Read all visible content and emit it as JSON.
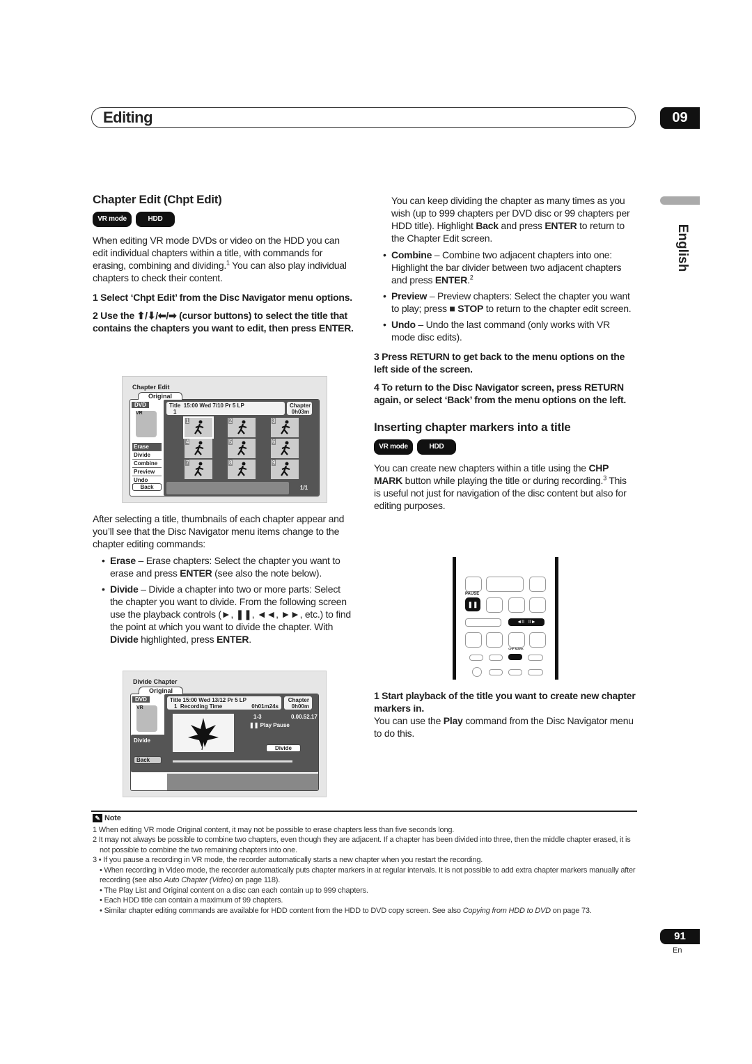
{
  "header": {
    "section_title": "Editing",
    "chapter_number": "09",
    "language_tab": "English"
  },
  "left": {
    "heading": "Chapter Edit (Chpt Edit)",
    "badges": [
      "VR mode",
      "HDD"
    ],
    "intro": [
      {
        "t": "When editing VR mode DVDs or video on the HDD you can edit individual chapters within a title, with commands for erasing, combining and dividing."
      },
      {
        "sup": "1"
      },
      {
        "t": " You can also play individual chapters to check their content."
      }
    ],
    "step1": "1   Select ‘Chpt Edit’ from the Disc Navigator menu options.",
    "step2": "2   Use the ⬆/⬇/⬅/➡ (cursor buttons) to select the title that contains the chapters you want to edit, then press ENTER.",
    "after": "After selecting a title, thumbnails of each chapter appear and you’ll see that the Disc Navigator menu items change to the chapter editing commands:",
    "bullets": [
      [
        {
          "t": "Erase",
          "b": true
        },
        {
          "t": " – Erase chapters: Select the chapter you want to erase and press "
        },
        {
          "t": "ENTER",
          "b": true
        },
        {
          "t": " (see also the note below)."
        }
      ],
      [
        {
          "t": "Divide",
          "b": true
        },
        {
          "t": " – Divide a chapter into two or more parts: Select the chapter you want to divide. From the following screen use the playback controls (►, ❚❚, ◄◄, ►►, etc.) to find the point at which you want to divide the chapter. With "
        },
        {
          "t": "Divide",
          "b": true
        },
        {
          "t": " highlighted, press "
        },
        {
          "t": "ENTER",
          "b": true
        },
        {
          "t": "."
        }
      ]
    ]
  },
  "screen1": {
    "title": "Chapter Edit",
    "tab": "Original",
    "disc": "DVD",
    "disc_mode": "VR",
    "info_title": "Title",
    "info_title_num": "1",
    "info_text": "15:00 Wed  7/10 Pr 5   LP",
    "info_chapter": "Chapter",
    "info_chapter_time": "0h03m",
    "thumbnails": [
      "1",
      "2",
      "3",
      "4",
      "5",
      "6",
      "7",
      "8",
      "9"
    ],
    "menu": [
      "Erase",
      "Divide",
      "Combine",
      "Preview",
      "Undo"
    ],
    "selected_menu": "Erase",
    "back": "Back",
    "page": "1/1"
  },
  "screen2": {
    "title": "Divide Chapter",
    "tab": "Original",
    "disc": "DVD",
    "disc_mode": "VR",
    "info_title": "Title",
    "info_title_num": "1",
    "info_line1": "15:00 Wed  13/12   Pr 5     LP",
    "info_line2_label": "Recording Time",
    "info_line2_value": "0h01m24s",
    "info_chapter": "Chapter",
    "info_chapter_time": "0h00m",
    "chapter_pos": "1-3",
    "timecode": "0.00.52.17",
    "status": "❚❚ Play Pause",
    "menu_item": "Divide",
    "divide_button": "Divide",
    "back": "Back"
  },
  "right": {
    "cont": [
      {
        "t": "You can keep dividing the chapter as many times as you wish (up to 999 chapters per DVD disc or 99 chapters per HDD title). Highlight "
      },
      {
        "t": "Back",
        "b": true
      },
      {
        "t": " and press "
      },
      {
        "t": "ENTER",
        "b": true
      },
      {
        "t": " to return to the Chapter Edit screen."
      }
    ],
    "bullets": [
      [
        {
          "t": "Combine",
          "b": true
        },
        {
          "t": " – Combine two adjacent chapters into one: Highlight the bar divider between two adjacent chapters and press "
        },
        {
          "t": "ENTER",
          "b": true
        },
        {
          "t": "."
        },
        {
          "sup": "2"
        }
      ],
      [
        {
          "t": "Preview",
          "b": true
        },
        {
          "t": " – Preview chapters: Select the chapter you want to play; press ■ "
        },
        {
          "t": "STOP",
          "b": true
        },
        {
          "t": " to return to the chapter edit screen."
        }
      ],
      [
        {
          "t": "Undo",
          "b": true
        },
        {
          "t": " – Undo the last command (only works with VR mode disc edits)."
        }
      ]
    ],
    "step3": "3   Press RETURN to get back to the menu options on the left side of the screen.",
    "step4": "4   To return to the Disc Navigator screen, press RETURN again, or select ‘Back’ from the menu options on the left.",
    "heading2": "Inserting chapter markers into a title",
    "badges": [
      "VR mode",
      "HDD"
    ],
    "intro2": [
      {
        "t": "You can create new chapters within a title using the "
      },
      {
        "t": "CHP MARK",
        "b": true
      },
      {
        "t": " button while playing the title or during recording."
      },
      {
        "sup": "3"
      },
      {
        "t": " This is useful not just for navigation of the disc content but also for editing purposes."
      }
    ],
    "remote": {
      "pause_label": "PAUSE",
      "chp_mark_label": "CHP MARK"
    },
    "step1": "1   Start playback of the title you want to create new chapter markers in.",
    "step1_text": [
      {
        "t": "You can use the "
      },
      {
        "t": "Play",
        "b": true
      },
      {
        "t": " command from the Disc Navigator menu to do this."
      }
    ]
  },
  "notes": {
    "title": "Note",
    "items": [
      {
        "num": "1",
        "text": [
          {
            "t": "When editing VR mode Original content, it may not be possible to erase chapters less than five seconds long."
          }
        ]
      },
      {
        "num": "2",
        "text": [
          {
            "t": "It may not always be possible to combine two chapters, even though they are adjacent. If a chapter has been divided into three, then the middle chapter erased, it is not possible to combine the two remaining chapters into one."
          }
        ]
      },
      {
        "num": "3",
        "text": [
          {
            "t": "• If you pause a recording in VR mode, the recorder automatically starts a new chapter when you restart the recording."
          }
        ]
      },
      {
        "num": "",
        "text": [
          {
            "t": "• When recording in Video mode, the recorder automatically puts chapter markers in at regular intervals. It is not possible to add extra chapter markers manually after recording (see also "
          },
          {
            "t": "Auto Chapter (Video)",
            "i": true
          },
          {
            "t": " on page 118)."
          }
        ]
      },
      {
        "num": "",
        "text": [
          {
            "t": "• The Play List and Original content on a disc can each contain up to 999 chapters."
          }
        ]
      },
      {
        "num": "",
        "text": [
          {
            "t": "• Each HDD title can contain a maximum of 99 chapters."
          }
        ]
      },
      {
        "num": "",
        "text": [
          {
            "t": "• Similar chapter editing commands are available for HDD content from the HDD to DVD copy screen. See also "
          },
          {
            "t": "Copying from HDD to DVD",
            "i": true
          },
          {
            "t": " on page 73."
          }
        ]
      }
    ]
  },
  "footer": {
    "page_number": "91",
    "language_code": "En"
  }
}
